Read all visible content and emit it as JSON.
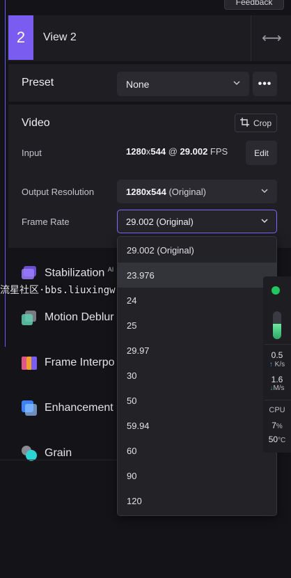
{
  "header": {
    "feedback_label": "Feedback"
  },
  "view": {
    "number": "2",
    "name": "View 2",
    "swap_icon": "swap-horizontal-icon"
  },
  "preset": {
    "label": "Preset",
    "value": "None",
    "more_label": "•••"
  },
  "video": {
    "title": "Video",
    "crop_label": "Crop",
    "input_label": "Input",
    "input_width": "1280",
    "input_x": "x",
    "input_height": "544",
    "input_at": " @ ",
    "input_fps": "29.002",
    "input_fps_unit": " FPS",
    "edit_label": "Edit",
    "output_label": "Output Resolution",
    "output_res": "1280x544",
    "output_suffix": " (Original)",
    "framerate_label": "Frame Rate",
    "framerate_value": "29.002 (Original)"
  },
  "framerate_options": [
    "29.002 (Original)",
    "23.976",
    "24",
    "25",
    "29.97",
    "30",
    "50",
    "59.94",
    "60",
    "90",
    "120"
  ],
  "features": [
    {
      "label": "Stabilization",
      "sup": "AI"
    },
    {
      "label": "Motion Deblur"
    },
    {
      "label": "Frame Interpo"
    },
    {
      "label": "Enhancement"
    },
    {
      "label": "Grain"
    }
  ],
  "watermark": "流星社区·bbs.liuxingw.com",
  "monitor": {
    "level_fraction": 0.55,
    "up_value": "0.5",
    "up_unit": "K/s",
    "down_value": "1.6",
    "down_unit": "M/s",
    "cpu_label": "CPU",
    "cpu_value": "7",
    "cpu_unit": "%",
    "temp_value": "50",
    "temp_unit": "°C"
  },
  "colors": {
    "accent": "#7b5cf0",
    "status_green": "#22c55e"
  }
}
